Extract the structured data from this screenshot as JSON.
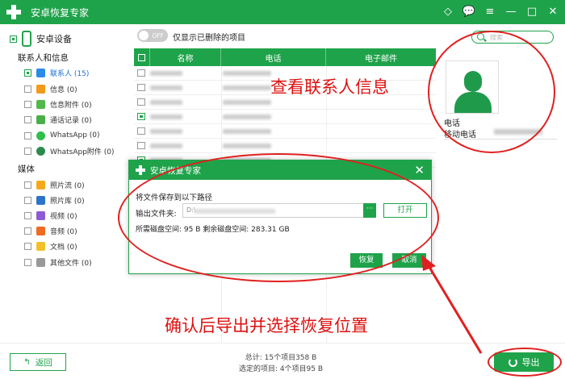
{
  "title": "安卓恢复专家",
  "sidebar": {
    "device": "安卓设备",
    "section_contacts": "联系人和信息",
    "contacts_items": [
      {
        "label": "联系人 (15)",
        "color": "#2c8be8"
      },
      {
        "label": "信息 (0)",
        "color": "#f29a1a"
      },
      {
        "label": "信息附件 (0)",
        "color": "#51b84c"
      },
      {
        "label": "通话记录 (0)",
        "color": "#4aaf4a"
      },
      {
        "label": "WhatsApp (0)",
        "color": "#2fbf4a"
      },
      {
        "label": "WhatsApp附件 (0)",
        "color": "#2d8a4e"
      }
    ],
    "section_media": "媒体",
    "media_items": [
      {
        "label": "照片流 (0)",
        "color": "#f6a81c"
      },
      {
        "label": "照片库 (0)",
        "color": "#2d74c9"
      },
      {
        "label": "视频 (0)",
        "color": "#8d5ad6"
      },
      {
        "label": "音频 (0)",
        "color": "#ef6a22"
      },
      {
        "label": "文档 (0)",
        "color": "#f3c02b"
      },
      {
        "label": "其他文件 (0)",
        "color": "#999999"
      }
    ]
  },
  "toolbar": {
    "toggle": "OFF",
    "toggle_label": "仅显示已删除的项目",
    "search_placeholder": "搜索"
  },
  "table": {
    "headers": [
      "名称",
      "电话",
      "电子邮件"
    ]
  },
  "detail": {
    "phone_label": "电话",
    "mobile_label": "移动电话"
  },
  "dialog": {
    "title": "安卓恢复专家",
    "line1": "将文件保存到以下路径",
    "path_label": "输出文件夹:",
    "path_prefix": "D:\\",
    "more": "···",
    "open": "打开",
    "space": "所需磁盘空间:  95 B  剩余磁盘空间:  283.31 GB",
    "recover": "恢复",
    "cancel": "取消"
  },
  "annotations": {
    "view_contacts": "查看联系人信息",
    "confirm_export": "确认后导出并选择恢复位置"
  },
  "footer": {
    "back": "返回",
    "total": "总计: 15个项目358 B",
    "selected": "选定的项目: 4个项目95 B",
    "export": "导出"
  }
}
